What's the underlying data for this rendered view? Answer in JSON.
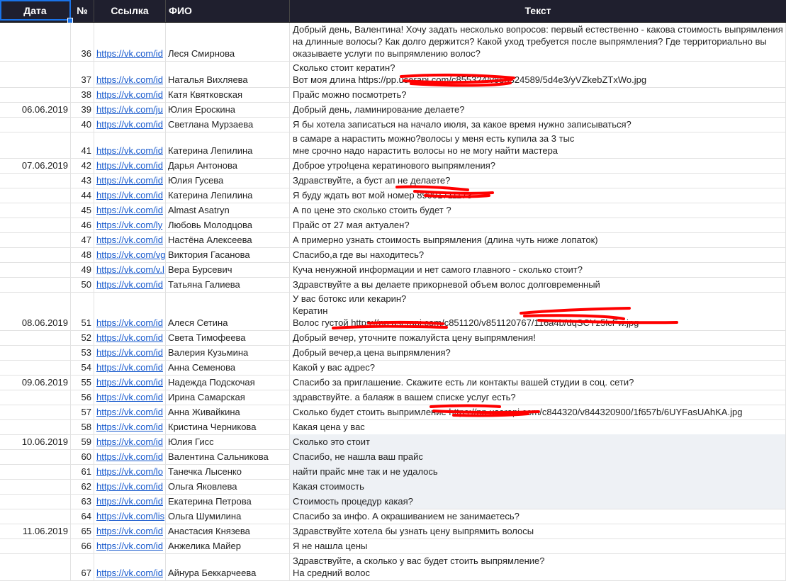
{
  "headers": {
    "date": "Дата",
    "num": "№",
    "link": "Ссылка",
    "name": "ФИО",
    "text": "Текст"
  },
  "rows": [
    {
      "date": "",
      "num": "36",
      "link": "https://vk.com/id",
      "name": "Леся Смирнова",
      "text": "Добрый день, Валентина! Хочу задать несколько вопросов: первый естественно - какова стоимость выпрямления\nна длинные волосы? Как долго держится? Какой уход требуется после выпрямления? Где территориально вы\nоказываете услуги по выпрямлению волос?"
    },
    {
      "date": "",
      "num": "37",
      "link": "https://vk.com/id",
      "name": "Наталья Вихляева",
      "text": "Сколько стоит кератин?\nВот моя длина https://pp.userapi.com/c855324/v855324589/5d4e3/yVZkebZTxWo.jpg"
    },
    {
      "date": "",
      "num": "38",
      "link": "https://vk.com/id",
      "name": "Катя Квятковская",
      "text": "Прайс можно посмотреть?"
    },
    {
      "date": "06.06.2019",
      "num": "39",
      "link": "https://vk.com/ju",
      "name": "Юлия Ероскина",
      "text": "Добрый день, ламинирование делаете?"
    },
    {
      "date": "",
      "num": "40",
      "link": "https://vk.com/id",
      "name": "Светлана Мурзаева",
      "text": "Я бы хотела записаться на начало июля, за какое время нужно записываться?"
    },
    {
      "date": "",
      "num": "41",
      "link": "https://vk.com/id",
      "name": "Катерина Лепилина",
      "text": "в самаре а нарастить можно?волосы у меня есть купила за 3 тыс\nмне срочно надо нарастить волосы но не могу найти мастера"
    },
    {
      "date": "07.06.2019",
      "num": "42",
      "link": "https://vk.com/id",
      "name": "Дарья Антонова",
      "text": "Доброе утро!цена кератинового выпрямления?"
    },
    {
      "date": "",
      "num": "43",
      "link": "https://vk.com/id",
      "name": "Юлия Гусева",
      "text": "Здравствуйте, а буст ап не делаете?"
    },
    {
      "date": "",
      "num": "44",
      "link": "https://vk.com/id",
      "name": "Катерина Лепилина",
      "text": "Я буду ждать вот мой номер 89001711173"
    },
    {
      "date": "",
      "num": "45",
      "link": "https://vk.com/id",
      "name": "Almast Asatryn",
      "text": "А по цене это сколько стоить будет ?"
    },
    {
      "date": "",
      "num": "46",
      "link": "https://vk.com/ly",
      "name": "Любовь Молодцова",
      "text": "Прайс от 27 мая актуален?"
    },
    {
      "date": "",
      "num": "47",
      "link": "https://vk.com/id",
      "name": "Настёна Алексеева",
      "text": "А примерно узнать стоимость выпрямления (длина чуть ниже лопаток)"
    },
    {
      "date": "",
      "num": "48",
      "link": "https://vk.com/vg",
      "name": "Виктория Гасанова",
      "text": "Спасибо,а где вы находитесь?"
    },
    {
      "date": "",
      "num": "49",
      "link": "https://vk.com/v.l",
      "name": "Вера Бурсевич",
      "text": "Куча ненужной информации и нет самого главного - сколько стоит?"
    },
    {
      "date": "",
      "num": "50",
      "link": "https://vk.com/id",
      "name": "Татьяна Галиева",
      "text": "Здравствуйте а вы делаете прикорневой объем волос долговременный"
    },
    {
      "date": "08.06.2019",
      "num": "51",
      "link": "https://vk.com/id",
      "name": "Алеся Сетина",
      "text": "У вас ботокс или кекарин?\nКератин\nВолос густой https://pp.userapi.com/c851120/v851120767/116a4b/dqSCYz5lcFw.jpg"
    },
    {
      "date": "",
      "num": "52",
      "link": "https://vk.com/id",
      "name": "Света Тимофеева",
      "text": "Добрый вечер, уточните пожалуйста цену выпрямления!"
    },
    {
      "date": "",
      "num": "53",
      "link": "https://vk.com/id",
      "name": "Валерия Кузьмина",
      "text": "Добрый вечер,а цена выпрямления?"
    },
    {
      "date": "",
      "num": "54",
      "link": "https://vk.com/id",
      "name": "Анна Семенова",
      "text": "Какой у вас адрес?"
    },
    {
      "date": "09.06.2019",
      "num": "55",
      "link": "https://vk.com/id",
      "name": "Надежда Подскочая",
      "text": "Спасибо за приглашение. Скажите есть ли контакты вашей студии в соц. сети?"
    },
    {
      "date": "",
      "num": "56",
      "link": "https://vk.com/id",
      "name": "Ирина Самарская",
      "text": "здравствуйте. а балаяж в вашем списке услуг есть?"
    },
    {
      "date": "",
      "num": "57",
      "link": "https://vk.com/id",
      "name": "Анна Живайкина",
      "text": "Сколько будет стоить выпримление https://pp.userapi.com/c844320/v844320900/1f657b/6UYFasUAhKA.jpg"
    },
    {
      "date": "",
      "num": "58",
      "link": "https://vk.com/id",
      "name": "Кристина Черникова",
      "text": "Какая цена у вас"
    },
    {
      "date": "10.06.2019",
      "num": "59",
      "link": "https://vk.com/id",
      "name": "Юлия Гисс",
      "text": "Сколько это стоит"
    },
    {
      "date": "",
      "num": "60",
      "link": "https://vk.com/id",
      "name": "Валентина Сальникова",
      "text": "Спасибо, не нашла ваш прайс"
    },
    {
      "date": "",
      "num": "61",
      "link": "https://vk.com/lo",
      "name": "Танечка Лысенко",
      "text": "найти прайс мне так и не удалось"
    },
    {
      "date": "",
      "num": "62",
      "link": "https://vk.com/id",
      "name": "Ольга Яковлева",
      "text": "Какая стоимость"
    },
    {
      "date": "",
      "num": "63",
      "link": "https://vk.com/id",
      "name": "Екатерина Петрова",
      "text": "Стоимость процедур какая?"
    },
    {
      "date": "",
      "num": "64",
      "link": "https://vk.com/lis",
      "name": "Ольга Шумилина",
      "text": "Спасибо за инфо. А окрашиванием не занимаетесь?"
    },
    {
      "date": "11.06.2019",
      "num": "65",
      "link": "https://vk.com/id",
      "name": "Анастасия Князева",
      "text": "Здравствуйте хотела бы узнать цену выпрямить волосы"
    },
    {
      "date": "",
      "num": "66",
      "link": "https://vk.com/id",
      "name": "Анжелика Майер",
      "text": "Я не нашла цены"
    },
    {
      "date": "",
      "num": "67",
      "link": "https://vk.com/id",
      "name": "Айнура Беккарчеева",
      "text": "Здравствуйте, а сколько у вас будет стоить выпрямление?\nНа средний волос"
    }
  ],
  "shaded_rows": [
    23,
    24,
    25,
    26,
    27
  ],
  "redaction_color": "#ff0000"
}
